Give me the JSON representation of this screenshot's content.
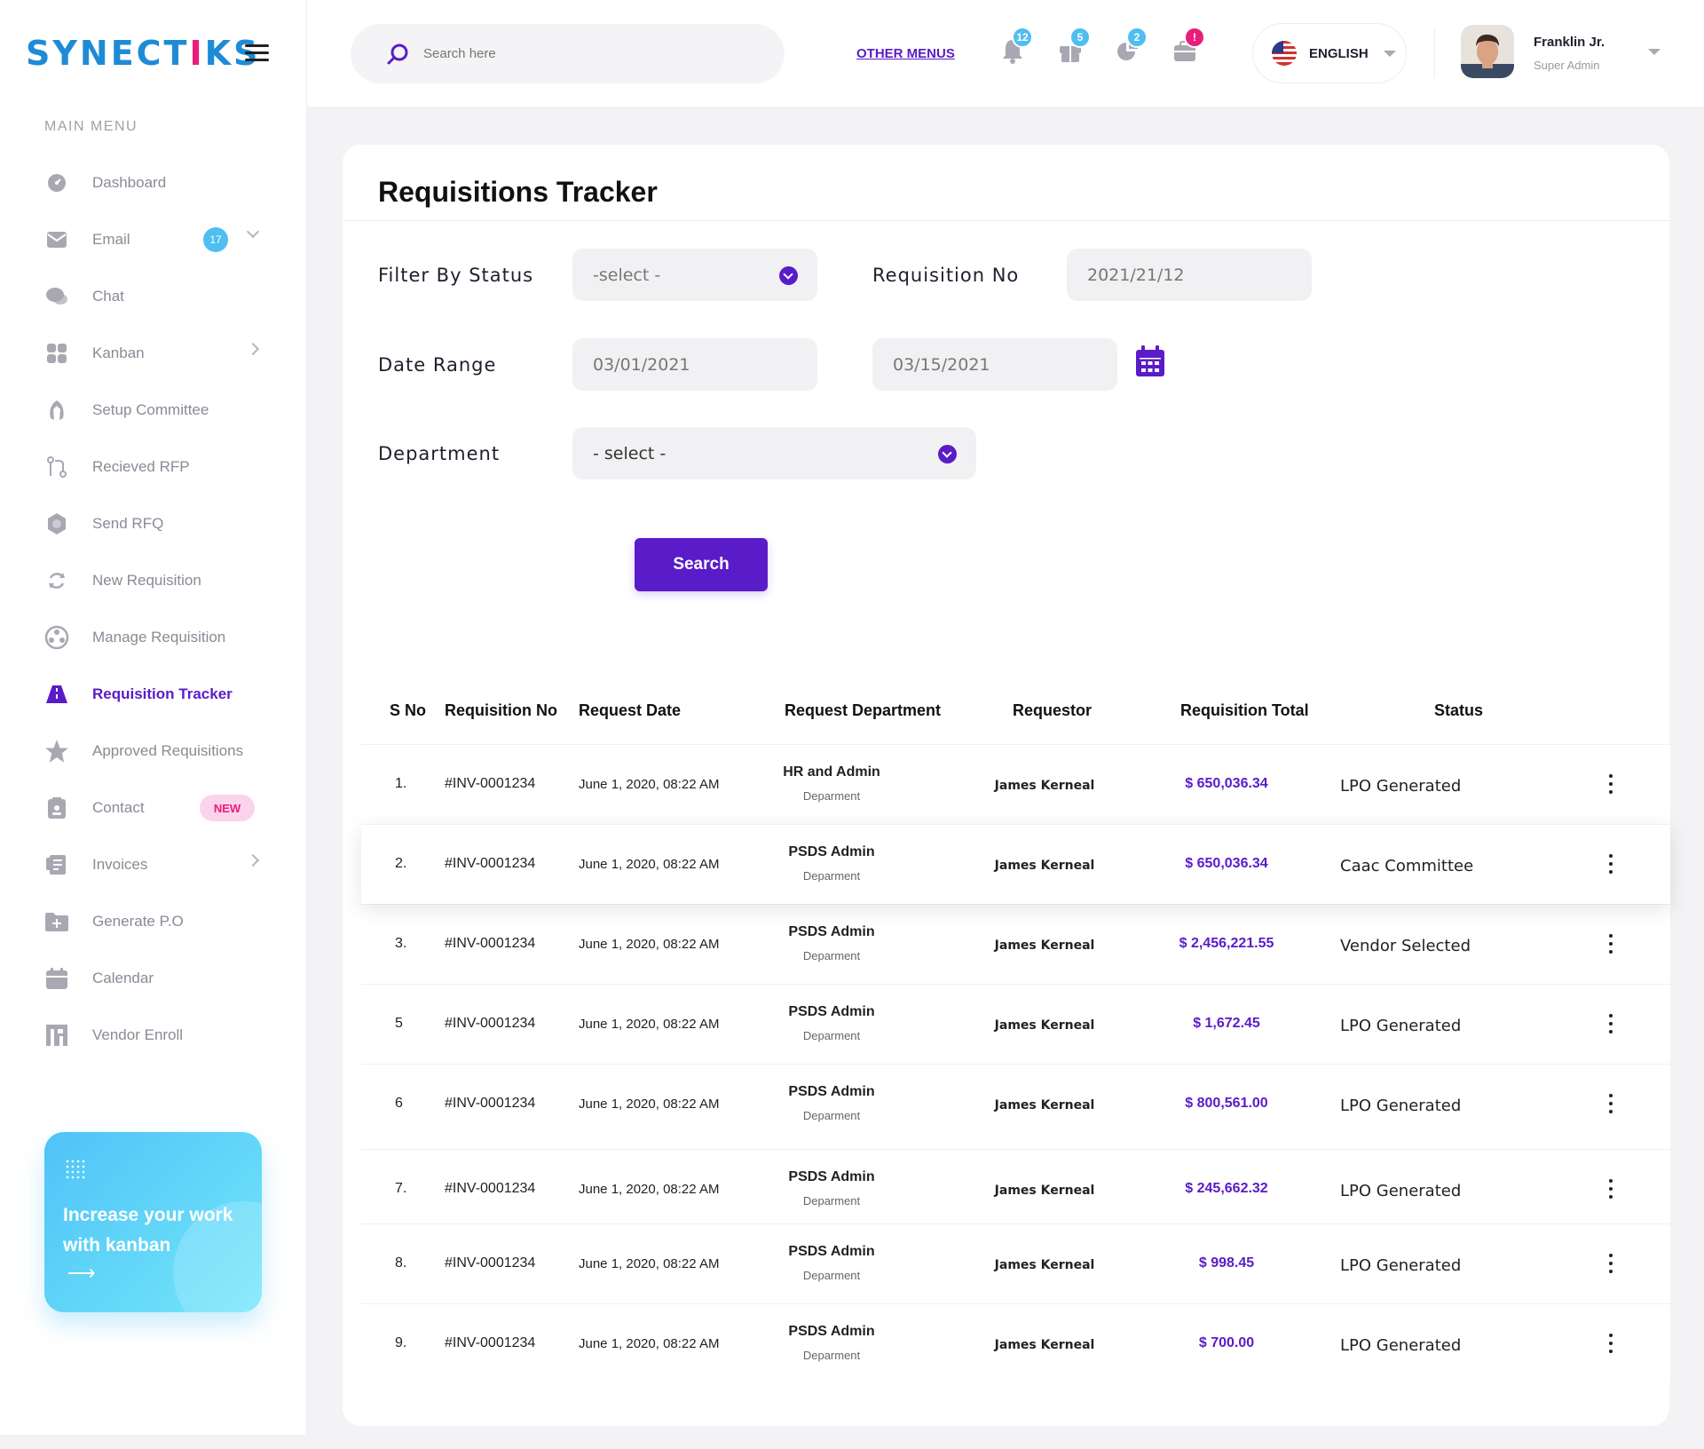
{
  "brand": {
    "logo_a": "SYNECT",
    "logo_i": "I",
    "logo_b": "KS"
  },
  "sidebar": {
    "title": "MAIN MENU",
    "items": [
      {
        "label": "Dashboard",
        "icon": "dashboard-icon"
      },
      {
        "label": "Email",
        "icon": "email-icon",
        "badge": "17"
      },
      {
        "label": "Chat",
        "icon": "chat-icon"
      },
      {
        "label": "Kanban",
        "icon": "kanban-icon"
      },
      {
        "label": "Setup Committee",
        "icon": "committee-icon"
      },
      {
        "label": "Recieved RFP",
        "icon": "rfp-icon"
      },
      {
        "label": "Send RFQ",
        "icon": "rfq-icon"
      },
      {
        "label": "New Requisition",
        "icon": "refresh-icon"
      },
      {
        "label": "Manage Requisition",
        "icon": "manage-icon"
      },
      {
        "label": "Requisition Tracker",
        "icon": "road-icon"
      },
      {
        "label": "Approved Requisitions",
        "icon": "star-icon"
      },
      {
        "label": "Contact",
        "icon": "contact-icon",
        "badge": "NEW"
      },
      {
        "label": "Invoices",
        "icon": "invoice-icon"
      },
      {
        "label": "Generate P.O",
        "icon": "folder-plus-icon"
      },
      {
        "label": "Calendar",
        "icon": "calendar-icon"
      },
      {
        "label": "Vendor Enroll",
        "icon": "vendor-icon"
      }
    ],
    "promo": {
      "text": "Increase your work with kanban",
      "arrow": "⟶"
    }
  },
  "topbar": {
    "search_placeholder": "Search here",
    "other_menus": "OTHER MENUS",
    "notifications": [
      {
        "icon": "bell-icon",
        "count": "12",
        "color": "#4fbef0"
      },
      {
        "icon": "gift-icon",
        "count": "5",
        "color": "#4fbef0"
      },
      {
        "icon": "pie-chart-icon",
        "count": "2",
        "color": "#4fbef0"
      },
      {
        "icon": "briefcase-icon",
        "count": "!",
        "color": "#e91e7a"
      }
    ],
    "language": "ENGLISH",
    "user": {
      "name": "Franklin Jr.",
      "role": "Super Admin"
    }
  },
  "page": {
    "title": "Requisitions Tracker",
    "filter_status_label": "Filter By Status",
    "filter_status_value": "-select -",
    "req_no_label": "Requisition No",
    "req_no_value": "2021/21/12",
    "date_range_label": "Date Range",
    "date_from": "03/01/2021",
    "date_to": "03/15/2021",
    "department_label": "Department",
    "department_value": "- select -",
    "search_button": "Search"
  },
  "table": {
    "headers": [
      "S No",
      "Requisition No",
      "Request Date",
      "Request Department",
      "Requestor",
      "Requisition Total",
      "Status"
    ],
    "rows": [
      {
        "sno": "1.",
        "req_no": "#INV-0001234",
        "date": "June 1, 2020, 08:22 AM",
        "dept": "HR and Admin",
        "dept_sub": "Deparment",
        "requestor": "James Kerneal",
        "total": "$ 650,036.34",
        "status": "LPO Generated"
      },
      {
        "sno": "2.",
        "req_no": "#INV-0001234",
        "date": "June 1, 2020, 08:22 AM",
        "dept": "PSDS Admin",
        "dept_sub": "Deparment",
        "requestor": "James Kerneal",
        "total": "$ 650,036.34",
        "status": "Caac Committee"
      },
      {
        "sno": "3.",
        "req_no": "#INV-0001234",
        "date": "June 1, 2020, 08:22 AM",
        "dept": "PSDS Admin",
        "dept_sub": "Deparment",
        "requestor": "James Kerneal",
        "total": "$ 2,456,221.55",
        "status": "Vendor Selected"
      },
      {
        "sno": "5",
        "req_no": "#INV-0001234",
        "date": "June 1, 2020, 08:22 AM",
        "dept": "PSDS Admin",
        "dept_sub": "Deparment",
        "requestor": "James Kerneal",
        "total": "$ 1,672.45",
        "status": "LPO Generated"
      },
      {
        "sno": "6",
        "req_no": "#INV-0001234",
        "date": "June 1, 2020, 08:22 AM",
        "dept": "PSDS Admin",
        "dept_sub": "Deparment",
        "requestor": "James Kerneal",
        "total": "$ 800,561.00",
        "status": "LPO Generated"
      },
      {
        "sno": "7.",
        "req_no": "#INV-0001234",
        "date": "June 1, 2020, 08:22 AM",
        "dept": "PSDS Admin",
        "dept_sub": "Deparment",
        "requestor": "James Kerneal",
        "total": "$ 245,662.32",
        "status": "LPO Generated"
      },
      {
        "sno": "8.",
        "req_no": "#INV-0001234",
        "date": "June 1, 2020, 08:22 AM",
        "dept": "PSDS Admin",
        "dept_sub": "Deparment",
        "requestor": "James Kerneal",
        "total": "$ 998.45",
        "status": "LPO Generated"
      },
      {
        "sno": "9.",
        "req_no": "#INV-0001234",
        "date": "June 1, 2020, 08:22 AM",
        "dept": "PSDS Admin",
        "dept_sub": "Deparment",
        "requestor": "James Kerneal",
        "total": "$ 700.00",
        "status": "LPO Generated"
      }
    ]
  },
  "colors": {
    "accent": "#5a1bc8",
    "badge_blue": "#4fbef0",
    "badge_pink": "#e91e7a",
    "logo_blue": "#1f8bd6"
  }
}
